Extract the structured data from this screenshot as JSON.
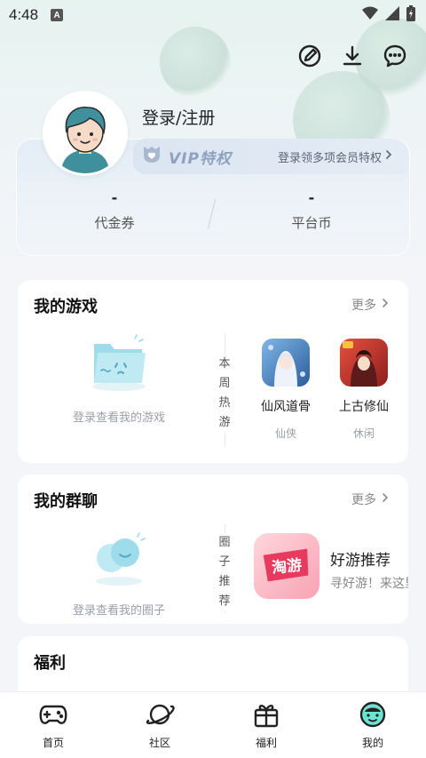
{
  "status_bar": {
    "time": "4:48",
    "notification_icon": "A"
  },
  "profile": {
    "login_label": "登录/注册",
    "vip_label": "VIP特权",
    "vip_link": "登录领多项会员特权",
    "stats": [
      {
        "value": "-",
        "label": "代金券"
      },
      {
        "value": "-",
        "label": "平台币"
      }
    ]
  },
  "my_games": {
    "title": "我的游戏",
    "more": "更多",
    "empty_text": "登录查看我的游戏",
    "side_label": "本\n周\n热\n游",
    "games": [
      {
        "name": "仙风道骨",
        "tag": "仙侠"
      },
      {
        "name": "上古修仙",
        "tag": "休闲"
      }
    ]
  },
  "my_groups": {
    "title": "我的群聊",
    "more": "更多",
    "empty_text": "登录查看我的圈子",
    "side_label": "圈\n子\n推\n荐",
    "group": {
      "icon_text": "淘游",
      "name": "好游推荐",
      "desc": "寻好游！来这里"
    }
  },
  "welfare": {
    "title": "福利"
  },
  "tabbar": {
    "tabs": [
      {
        "label": "首页",
        "icon": "gamepad-icon"
      },
      {
        "label": "社区",
        "icon": "planet-icon"
      },
      {
        "label": "福利",
        "icon": "gift-icon"
      },
      {
        "label": "我的",
        "icon": "profile-face-icon"
      }
    ]
  }
}
